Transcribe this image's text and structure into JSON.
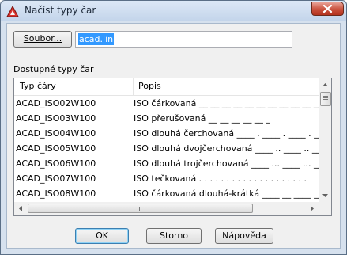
{
  "window": {
    "title": "Načíst typy čar",
    "close_symbol": "✕"
  },
  "file_button": {
    "label": "Soubor..."
  },
  "file_field": {
    "value": "acad.lin"
  },
  "list_label": "Dostupné typy čar",
  "table": {
    "columns": [
      "Typ čáry",
      "Popis"
    ],
    "rows": [
      {
        "name": "ACAD_ISO02W100",
        "desc": "ISO čárkovaná __ __ __ __ __ __ __ __ __ __ __"
      },
      {
        "name": "ACAD_ISO03W100",
        "desc": "ISO přerušovaná __    __    __    __    __    _"
      },
      {
        "name": "ACAD_ISO04W100",
        "desc": "ISO dlouhá čerchovaná ____ . ____ . ____ . ____"
      },
      {
        "name": "ACAD_ISO05W100",
        "desc": "ISO dlouhá dvojčerchovaná ____ .. ____ .. ____"
      },
      {
        "name": "ACAD_ISO06W100",
        "desc": "ISO dlouhá trojčerchovaná ____ ... ____ ... ____"
      },
      {
        "name": "ACAD_ISO07W100",
        "desc": "ISO tečkovaná . . . . . . . . . . . . . . . . . . . ."
      },
      {
        "name": "ACAD_ISO08W100",
        "desc": "ISO čárkovaná dlouhá-krátká ____ __ ____ __ ____"
      }
    ]
  },
  "buttons": {
    "ok": "OK",
    "cancel": "Storno",
    "help": "Nápověda"
  },
  "colors": {
    "selection": "#3399ff",
    "close_button": "#c9503c"
  }
}
